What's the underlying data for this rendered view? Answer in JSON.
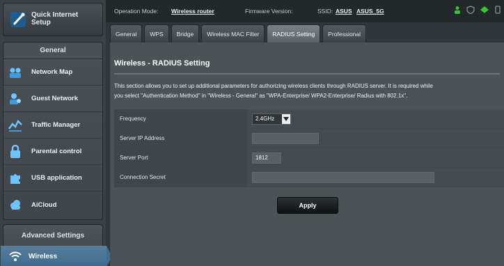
{
  "sidebar": {
    "quick_setup_label": "Quick Internet Setup",
    "general_header": "General",
    "items": [
      {
        "label": "Network Map",
        "icon": "network-map-icon"
      },
      {
        "label": "Guest Network",
        "icon": "guest-network-icon"
      },
      {
        "label": "Traffic Manager",
        "icon": "traffic-manager-icon"
      },
      {
        "label": "Parental control",
        "icon": "lock-icon"
      },
      {
        "label": "USB application",
        "icon": "puzzle-icon"
      },
      {
        "label": "AiCloud",
        "icon": "cloud-icon"
      }
    ],
    "advanced_header": "Advanced Settings",
    "advanced_item": "Wireless"
  },
  "topbar": {
    "op_mode_label": "Operation Mode:",
    "op_mode_value": "Wireless router",
    "fw_label": "Firmware Version:",
    "ssid_label": "SSID:",
    "ssid_1": "ASUS",
    "ssid_2": "ASUS_5G"
  },
  "tabs": [
    {
      "label": "General"
    },
    {
      "label": "WPS"
    },
    {
      "label": "Bridge"
    },
    {
      "label": "Wireless MAC Filter"
    },
    {
      "label": "RADIUS Setting"
    },
    {
      "label": "Professional"
    }
  ],
  "main": {
    "title": "Wireless - RADIUS Setting",
    "desc_line1": "This section allows you to set up additional parameters for authorizing wireless clients through RADIUS server. It is required while",
    "desc_line2": "you select \"Authentication Method\" in \"Wireless - General\" as \"WPA-Enterprise/ WPA2-Enterprise/ Radius with 802.1x\".",
    "fields": [
      {
        "label": "Frequency",
        "value": "2.4GHz"
      },
      {
        "label": "Server IP Address",
        "value": ""
      },
      {
        "label": "Server Port",
        "value": "1812"
      },
      {
        "label": "Connection Secret",
        "value": ""
      }
    ],
    "apply_label": "Apply"
  },
  "colors": {
    "accent": "#3b6a8f",
    "status_green": "#39c43a"
  }
}
